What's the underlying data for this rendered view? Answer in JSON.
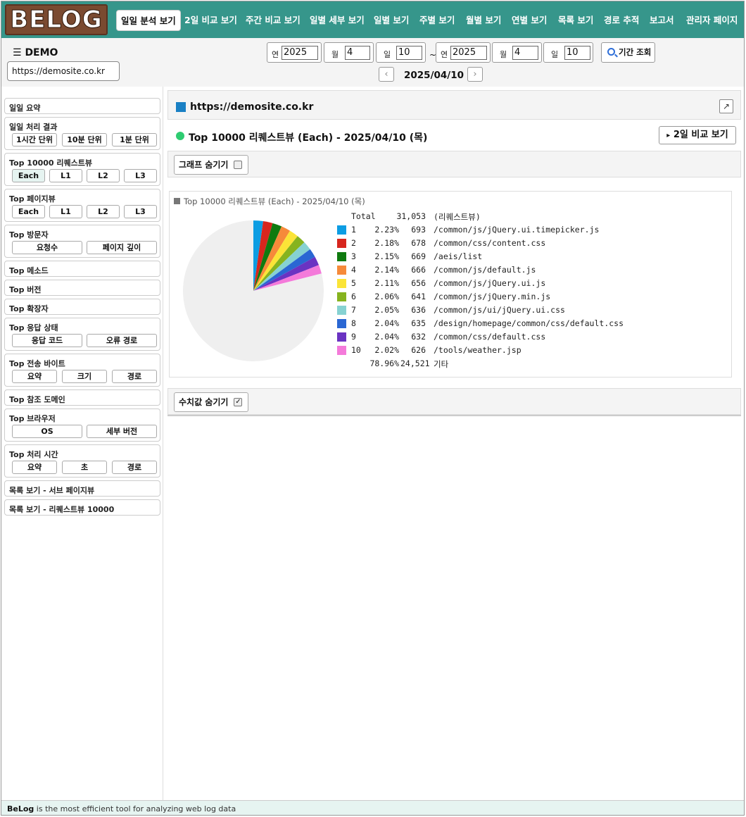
{
  "brand": {
    "logo_text": "BELOG"
  },
  "nav": {
    "items": [
      "일일 분석 보기",
      "2일 비교 보기",
      "주간 비교 보기",
      "일별 세부 보기",
      "일별 보기",
      "주별 보기",
      "월별 보기",
      "연별 보기",
      "목록 보기",
      "경로 추적",
      "보고서",
      "관리자 페이지"
    ],
    "active": "일일 분석 보기"
  },
  "header": {
    "menu_title": "DEMO",
    "site_url": "https://demosite.co.kr",
    "from": {
      "year_label": "연",
      "year": "2025",
      "month_label": "월",
      "month": "4",
      "day_label": "일",
      "day": "10"
    },
    "to": {
      "year_label": "연",
      "year": "2025",
      "month_label": "월",
      "month": "4",
      "day_label": "일",
      "day": "10"
    },
    "tilde": "~",
    "query_label": "기간 조회",
    "current_date": "2025/04/10",
    "prev": "‹",
    "next": "›"
  },
  "sidebar": {
    "daily_summary": "일일 요약",
    "daily_process": {
      "title": "일일 처리 결과",
      "buttons": [
        "1시간 단위",
        "10분 단위",
        "1분 단위"
      ]
    },
    "top_request": {
      "title": "Top 10000 리퀘스트뷰",
      "buttons": [
        "Each",
        "L1",
        "L2",
        "L3"
      ]
    },
    "top_page": {
      "title": "Top 페이지뷰",
      "buttons": [
        "Each",
        "L1",
        "L2",
        "L3"
      ]
    },
    "top_visitor": {
      "title": "Top 방문자",
      "buttons": [
        "요청수",
        "페이지 깊이"
      ]
    },
    "top_method": "Top 메소드",
    "top_version": "Top 버전",
    "top_ext": "Top 확장자",
    "top_status": {
      "title": "Top 응답 상태",
      "buttons": [
        "응답 코드",
        "오류 경로"
      ]
    },
    "top_bytes": {
      "title": "Top 전송 바이트",
      "buttons": [
        "요약",
        "크기",
        "경로"
      ]
    },
    "top_ref": "Top 참조 도메인",
    "top_browser": {
      "title": "Top 브라우저",
      "buttons": [
        "OS",
        "세부 버전"
      ]
    },
    "top_time": {
      "title": "Top 처리 시간",
      "buttons": [
        "요약",
        "초",
        "경로"
      ]
    },
    "list_sub": "목록 보기 - 서브 페이지뷰",
    "list_req": "목록 보기 - 리퀘스트뷰 10000"
  },
  "main": {
    "site_title": "https://demosite.co.kr",
    "ext_icon": "↗",
    "report_title": "Top 10000 리퀘스트뷰 (Each) - 2025/04/10 (목)",
    "compare_label": "2일 비교 보기",
    "compare_arrow": "▸",
    "graph_toggle": "그래프 숨기기",
    "value_toggle": "수치값 숨기기",
    "value_check": "✓"
  },
  "chart_data": {
    "type": "pie",
    "title": "Top 10000 리퀘스트뷰 (Each) - 2025/04/10 (목)",
    "total_label": "Total",
    "total": "31,053",
    "unit_label": "(리퀘스트뷰)",
    "slices": [
      {
        "rank": "1",
        "pct": "2.23%",
        "value": 693,
        "value_label": "693",
        "path": "/common/js/jQuery.ui.timepicker.js",
        "color": "#0c9de3"
      },
      {
        "rank": "2",
        "pct": "2.18%",
        "value": 678,
        "value_label": "678",
        "path": "/common/css/content.css",
        "color": "#d7261e"
      },
      {
        "rank": "3",
        "pct": "2.15%",
        "value": 669,
        "value_label": "669",
        "path": "/aeis/list",
        "color": "#0f7a0f"
      },
      {
        "rank": "4",
        "pct": "2.14%",
        "value": 666,
        "value_label": "666",
        "path": "/common/js/default.js",
        "color": "#f68a3a"
      },
      {
        "rank": "5",
        "pct": "2.11%",
        "value": 656,
        "value_label": "656",
        "path": "/common/js/jQuery.ui.js",
        "color": "#fbe437"
      },
      {
        "rank": "6",
        "pct": "2.06%",
        "value": 641,
        "value_label": "641",
        "path": "/common/js/jQuery.min.js",
        "color": "#86b31f"
      },
      {
        "rank": "7",
        "pct": "2.05%",
        "value": 636,
        "value_label": "636",
        "path": "/common/js/ui/jQuery.ui.css",
        "color": "#86d2d2"
      },
      {
        "rank": "8",
        "pct": "2.04%",
        "value": 635,
        "value_label": "635",
        "path": "/design/homepage/common/css/default.css",
        "color": "#2a67d3"
      },
      {
        "rank": "9",
        "pct": "2.04%",
        "value": 632,
        "value_label": "632",
        "path": "/common/css/default.css",
        "color": "#6a33c2"
      },
      {
        "rank": "10",
        "pct": "2.02%",
        "value": 626,
        "value_label": "626",
        "path": "/tools/weather.jsp",
        "color": "#f47ada"
      }
    ],
    "other": {
      "pct": "78.96%",
      "value": 24521,
      "value_label": "24,521",
      "label": "기타",
      "color": "#efefef"
    }
  },
  "footer": {
    "brand": "BeLog",
    "text": " is the most efficient tool for analyzing web log data"
  }
}
